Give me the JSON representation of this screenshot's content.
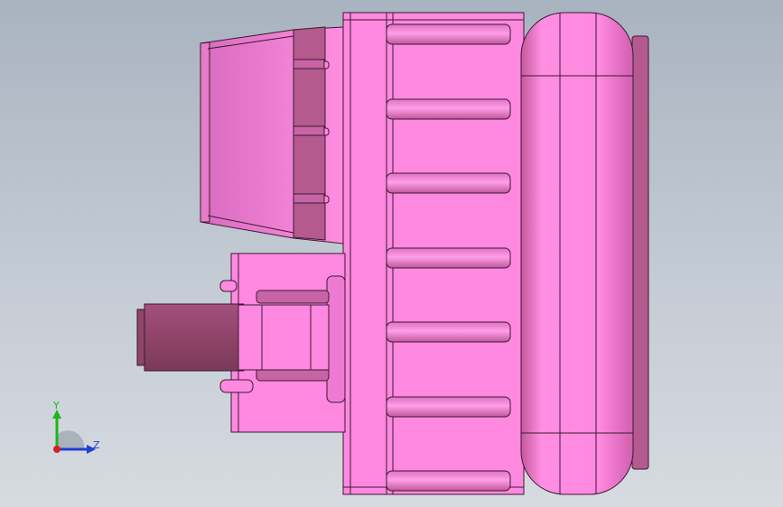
{
  "viewport": {
    "background_top": "#a9b3c0",
    "background_bottom": "#d6dbe1"
  },
  "model": {
    "color_main": "#ff88e0",
    "color_shadow": "#b45a8f",
    "color_dark": "#8f4468",
    "color_edge": "#3a1a30"
  },
  "triad": {
    "y_label": "Y",
    "z_label": "Z",
    "y_color": "#1fb41f",
    "z_color": "#1f3fd6",
    "x_color": "#d61f1f"
  }
}
